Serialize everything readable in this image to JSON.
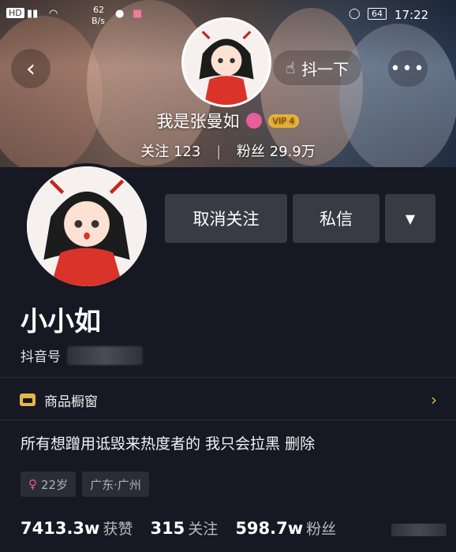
{
  "statusbar": {
    "carrier": "HD",
    "speed_value": "62",
    "speed_unit": "B/s",
    "battery": "64",
    "time": "17:22"
  },
  "header": {
    "shake_label": "抖一下",
    "banner_name": "我是张曼如",
    "vip_label": "VIP 4",
    "following_label": "关注",
    "following_count": "123",
    "fans_label": "粉丝",
    "fans_count": "29.9万"
  },
  "actions": {
    "unfollow_label": "取消关注",
    "message_label": "私信"
  },
  "profile": {
    "nickname": "小小如",
    "id_label": "抖音号",
    "shop_label": "商品橱窗",
    "bio": "所有想蹭用诋毁来热度者的  我只会拉黑 删除",
    "age_tag": "22岁",
    "location_tag": "广东·广州"
  },
  "stats": [
    {
      "num": "7413.3w",
      "label": "获赞"
    },
    {
      "num": "315",
      "label": "关注"
    },
    {
      "num": "598.7w",
      "label": "粉丝"
    }
  ],
  "colors": {
    "background": "#161823",
    "button": "#393b44",
    "accent": "#e6b64a"
  },
  "icons": [
    "back-icon",
    "hand-point-icon",
    "more-icon",
    "chevron-down-icon",
    "shop-icon",
    "chevron-right-icon",
    "female-icon"
  ]
}
